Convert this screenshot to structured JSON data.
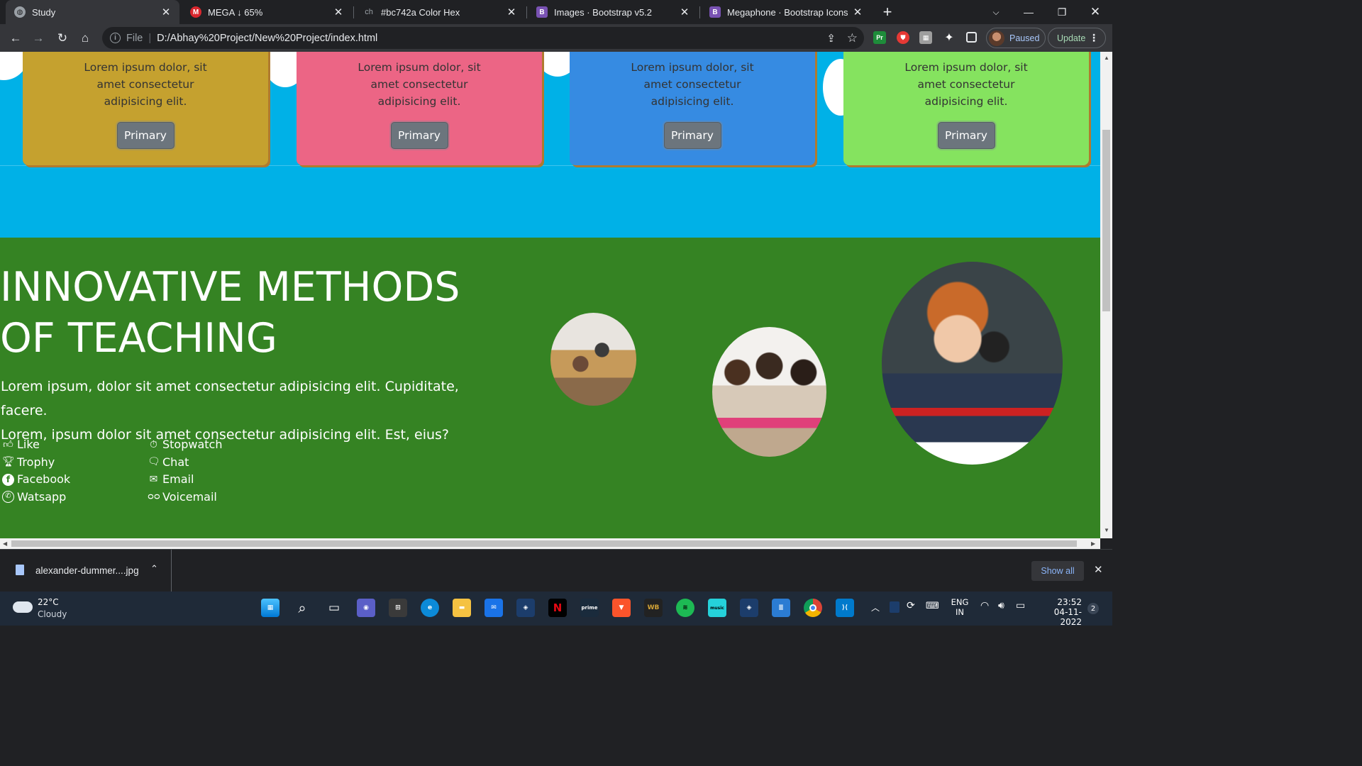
{
  "browser": {
    "tabs": [
      {
        "title": "Study",
        "active": true,
        "favicon": "globe-icon"
      },
      {
        "title": "MEGA ↓ 65%",
        "active": false,
        "favicon": "mega-icon"
      },
      {
        "title": "#bc742a Color Hex",
        "active": false,
        "favicon": "colorhex-icon"
      },
      {
        "title": "Images · Bootstrap v5.2",
        "active": false,
        "favicon": "bootstrap-icon"
      },
      {
        "title": "Megaphone · Bootstrap Icons",
        "active": false,
        "favicon": "bootstrap-icon"
      }
    ],
    "address": {
      "scheme": "File",
      "url": "D:/Abhay%20Project/New%20Project/index.html"
    },
    "profile_label": "Paused",
    "update_label": "Update"
  },
  "page": {
    "cards": [
      {
        "text": "Lorem ipsum dolor, sit amet consectetur adipisicing elit.",
        "button": "Primary",
        "color": "#c5a12f"
      },
      {
        "text": "Lorem ipsum dolor, sit amet consectetur adipisicing elit.",
        "button": "Primary",
        "color": "#ec6585"
      },
      {
        "text": "Lorem ipsum dolor, sit amet consectetur adipisicing elit.",
        "button": "Primary",
        "color": "#368be2"
      },
      {
        "text": "Lorem ipsum dolor, sit amet consectetur adipisicing elit.",
        "button": "Primary",
        "color": "#85e35f"
      }
    ],
    "hero": {
      "heading_line1": "INNOVATIVE METHODS",
      "heading_line2": "OF TEACHING",
      "lead_line1": "Lorem ipsum, dolor sit amet consectetur adipisicing elit. Cupiditate, facere.",
      "lead_line2": "Lorem, ipsum dolor sit amet consectetur adipisicing elit. Est, eius?"
    },
    "icon_list_left": [
      {
        "label": "Like",
        "icon": "hand-thumbs-up-icon"
      },
      {
        "label": "Trophy",
        "icon": "trophy-icon"
      },
      {
        "label": "Facebook",
        "icon": "facebook-icon"
      },
      {
        "label": "Watsapp",
        "icon": "whatsapp-icon"
      }
    ],
    "icon_list_right": [
      {
        "label": "Stopwatch",
        "icon": "stopwatch-icon"
      },
      {
        "label": "Chat",
        "icon": "chat-icon"
      },
      {
        "label": "Email",
        "icon": "envelope-open-icon"
      },
      {
        "label": "Voicemail",
        "icon": "voicemail-icon"
      }
    ],
    "colors": {
      "sky": "#00b1e7",
      "green": "#358323"
    }
  },
  "downloads": {
    "file_name": "alexander-dummer....jpg",
    "show_all": "Show all"
  },
  "taskbar": {
    "weather_temp": "22°C",
    "weather_desc": "Cloudy",
    "lang_top": "ENG",
    "lang_bottom": "IN",
    "time": "23:52",
    "date": "04-11-2022",
    "notification_count": "2"
  }
}
